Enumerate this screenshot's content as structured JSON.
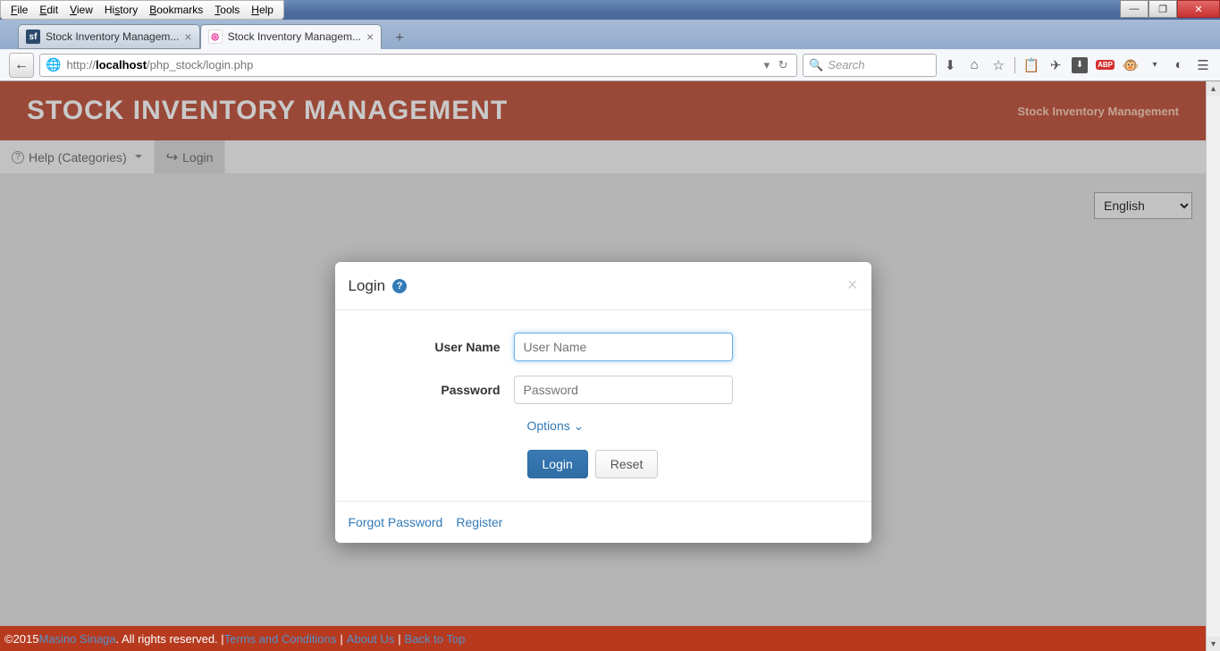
{
  "os_menu": [
    "File",
    "Edit",
    "View",
    "History",
    "Bookmarks",
    "Tools",
    "Help"
  ],
  "window_controls": {
    "min": "—",
    "max": "❐",
    "close": "✕"
  },
  "tabs": [
    {
      "favicon": "sf",
      "label": "Stock Inventory Managem..."
    },
    {
      "favicon": "pink",
      "label": "Stock Inventory Managem..."
    }
  ],
  "newtab_glyph": "+",
  "url_display_host": "localhost",
  "url_display_prefix": "http://",
  "url_display_path": "/php_stock/login.php",
  "reload_glyph": "↻",
  "dropdown_glyph": "▾",
  "search_placeholder": "Search",
  "toolbar_icons": [
    "⬇",
    "⌂",
    "☆",
    "📋",
    "✈",
    "⬇",
    "ABP",
    "🐵",
    "▾",
    "◐",
    "☰"
  ],
  "site_title": "STOCK INVENTORY MANAGEMENT",
  "site_sub": "Stock Inventory Management",
  "nav": {
    "help": "Help (Categories)",
    "login": "Login"
  },
  "lang_selected": "English",
  "modal": {
    "title": "Login",
    "username_label": "User Name",
    "username_placeholder": "User Name",
    "password_label": "Password",
    "password_placeholder": "Password",
    "options": "Options",
    "login_btn": "Login",
    "reset_btn": "Reset",
    "forgot": "Forgot Password",
    "register": "Register"
  },
  "footer": {
    "copyright": "©2015 ",
    "author": "Masino Sinaga",
    "rights": ". All rights reserved. | ",
    "terms": "Terms and Conditions",
    "about": "About Us",
    "back": "Back to Top"
  }
}
